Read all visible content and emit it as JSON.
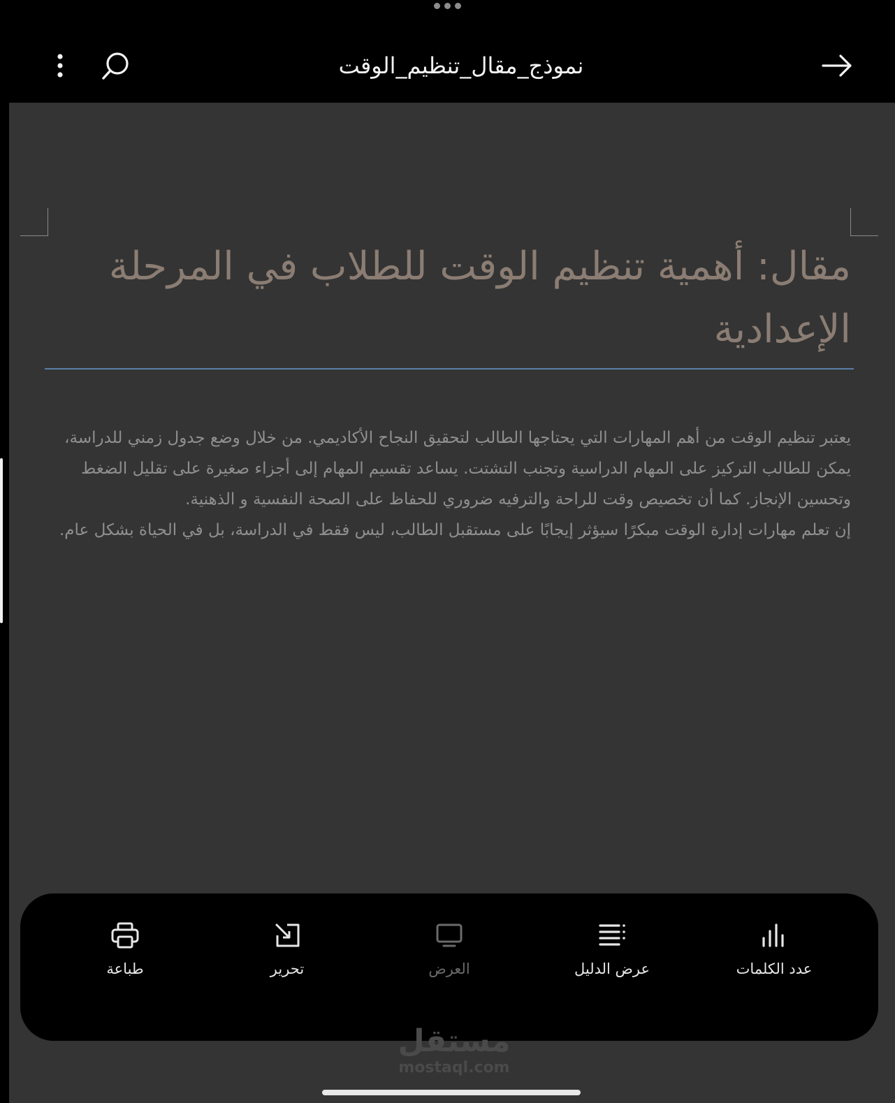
{
  "header": {
    "title": "نموذج_مقال_تنظيم_الوقت",
    "back_icon": "arrow-right-icon",
    "search_icon": "search-icon",
    "more_icon": "more-vertical-icon"
  },
  "document": {
    "title": "مقال: أهمية تنظيم الوقت للطلاب في المرحلة الإعدادية",
    "paragraphs": [
      "يعتبر تنظيم الوقت من أهم المهارات التي يحتاجها الطالب لتحقيق النجاح الأكاديمي. من خلال وضع جدول زمني للدراسة، يمكن للطالب التركيز على المهام الدراسية وتجنب التشتت. يساعد تقسيم المهام إلى أجزاء صغيرة على تقليل الضغط وتحسين الإنجاز. كما أن تخصيص وقت للراحة والترفيه ضروري للحفاظ على الصحة النفسية و الذهنية.",
      "إن تعلم مهارات إدارة الوقت مبكرًا سيؤثر إيجابًا على مستقبل الطالب، ليس فقط في الدراسة، بل في الحياة بشكل عام."
    ]
  },
  "toolbar": {
    "items": [
      {
        "label": "عدد الكلمات",
        "icon": "bar-chart-icon",
        "enabled": true
      },
      {
        "label": "عرض الدليل",
        "icon": "outline-list-icon",
        "enabled": true
      },
      {
        "label": "العرض",
        "icon": "monitor-icon",
        "enabled": false
      },
      {
        "label": "تحرير",
        "icon": "edit-icon",
        "enabled": true
      },
      {
        "label": "طباعة",
        "icon": "print-icon",
        "enabled": true
      }
    ]
  },
  "watermark": {
    "arabic": "مستقل",
    "latin": "mostaql.com"
  }
}
